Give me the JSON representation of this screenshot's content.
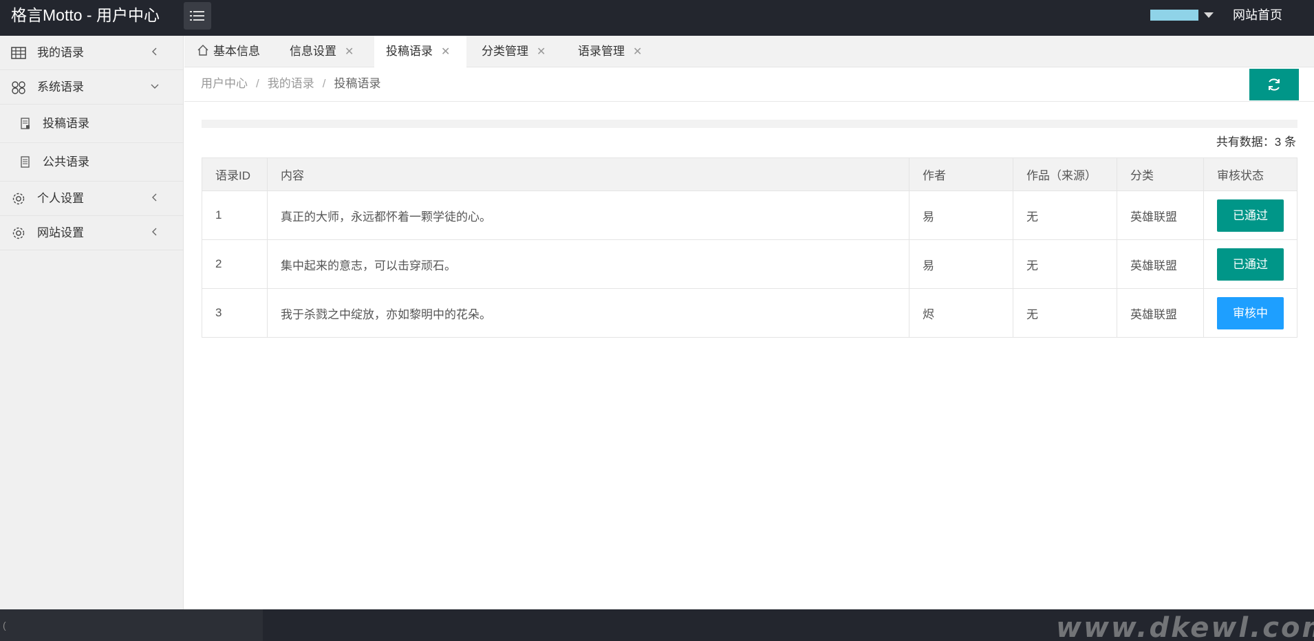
{
  "header": {
    "brand": "格言Motto - 用户中心",
    "user_name": "",
    "site_home": "网站首页"
  },
  "sidebar": {
    "items": [
      {
        "label": "我的语录",
        "icon": "table-icon",
        "arrow": "chevron-left-icon"
      },
      {
        "label": "系统语录",
        "icon": "apps-icon",
        "arrow": "chevron-down-icon"
      },
      {
        "label": "投稿语录",
        "icon": "document-icon"
      },
      {
        "label": "公共语录",
        "icon": "document-icon"
      },
      {
        "label": "个人设置",
        "icon": "gear-icon",
        "arrow": "chevron-left-icon"
      },
      {
        "label": "网站设置",
        "icon": "gear-icon",
        "arrow": "chevron-left-icon"
      }
    ]
  },
  "tabs": [
    {
      "label": "基本信息",
      "icon": "home-icon",
      "closable": false
    },
    {
      "label": "信息设置",
      "closable": true
    },
    {
      "label": "投稿语录",
      "closable": true,
      "active": true
    },
    {
      "label": "分类管理",
      "closable": true
    },
    {
      "label": "语录管理",
      "closable": true
    }
  ],
  "breadcrumb": [
    "用户中心",
    "我的语录",
    "投稿语录"
  ],
  "breadcrumb_separator": "/",
  "refresh_icon": "refresh-icon",
  "total_text": "共有数据：3 条",
  "table": {
    "headers": [
      "语录ID",
      "内容",
      "作者",
      "作品（来源）",
      "分类",
      "审核状态"
    ],
    "rows": [
      {
        "id": "1",
        "content": "真正的大师，永远都怀着一颗学徒的心。",
        "author": "易",
        "work": "无",
        "category": "英雄联盟",
        "status": "已通过"
      },
      {
        "id": "2",
        "content": "集中起来的意志，可以击穿顽石。",
        "author": "易",
        "work": "无",
        "category": "英雄联盟",
        "status": "已通过"
      },
      {
        "id": "3",
        "content": "我于杀戮之中绽放，亦如黎明中的花朵。",
        "author": "烬",
        "work": "无",
        "category": "英雄联盟",
        "status": "审核中"
      }
    ]
  },
  "footer": {
    "left_text": "("
  },
  "watermark": "www.dkewl.com",
  "colors": {
    "header_bg": "#23262e",
    "approved": "#009688",
    "pending": "#1e9fff",
    "refresh": "#009688"
  }
}
